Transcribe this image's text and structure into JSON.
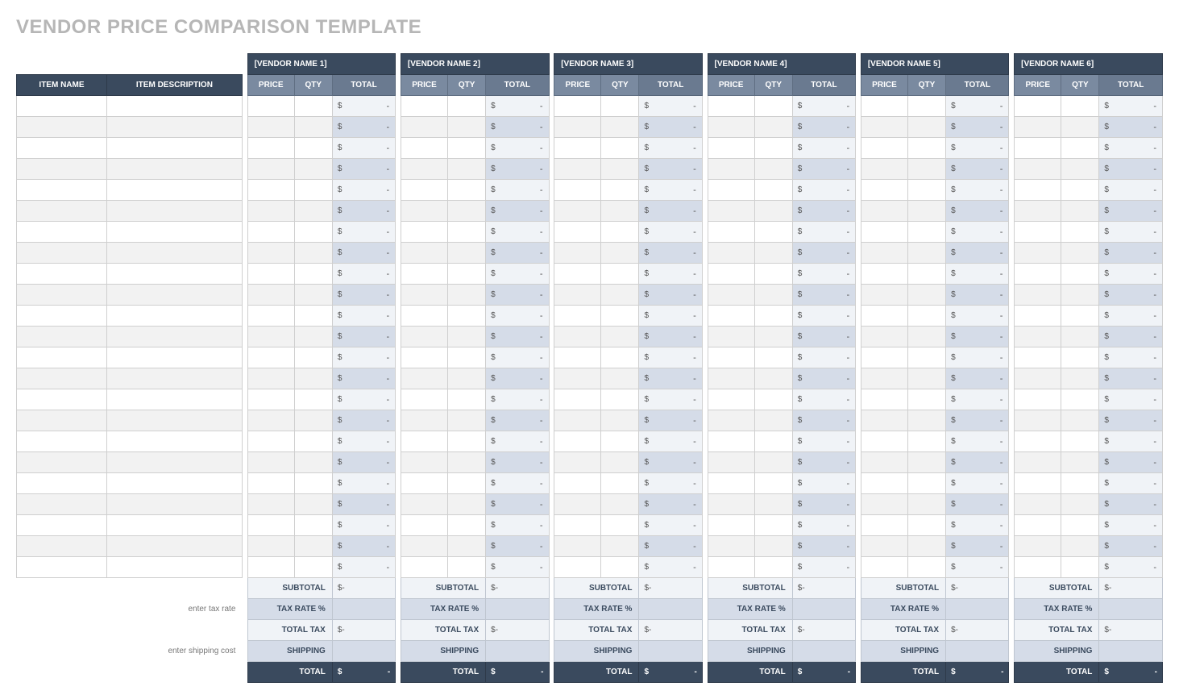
{
  "title": "VENDOR PRICE COMPARISON TEMPLATE",
  "headers": {
    "item_name": "ITEM NAME",
    "item_desc": "ITEM DESCRIPTION",
    "price": "PRICE",
    "qty": "QTY",
    "total": "TOTAL"
  },
  "vendors": [
    "[VENDOR NAME 1]",
    "[VENDOR NAME 2]",
    "[VENDOR NAME 3]",
    "[VENDOR NAME 4]",
    "[VENDOR NAME 5]",
    "[VENDOR NAME 6]"
  ],
  "row_count": 23,
  "cell_currency": "$",
  "cell_dash": "-",
  "footer": {
    "subtotal": "SUBTOTAL",
    "tax_rate_hint": "enter tax rate",
    "tax_rate": "TAX RATE %",
    "total_tax": "TOTAL TAX",
    "shipping_hint": "enter shipping cost",
    "shipping": "SHIPPING",
    "total": "TOTAL"
  }
}
